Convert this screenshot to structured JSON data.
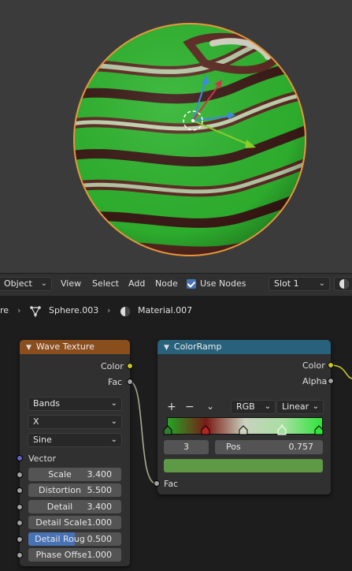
{
  "header": {
    "mode": "Object",
    "menu": [
      "View",
      "Select",
      "Add",
      "Node"
    ],
    "use_nodes_label": "Use Nodes",
    "use_nodes_checked": true,
    "slot": "Slot 1"
  },
  "breadcrumbs": {
    "truncated": "re",
    "object": "Sphere.003",
    "material": "Material.007"
  },
  "wave_node": {
    "title": "Wave Texture",
    "header_color": "#8a4d1c",
    "out_color": "Color",
    "out_fac": "Fac",
    "wave_type": "Bands",
    "direction": "X",
    "profile": "Sine",
    "vector_label": "Vector",
    "params": [
      {
        "label": "Scale",
        "value": "3.400"
      },
      {
        "label": "Distortion",
        "value": "5.500"
      },
      {
        "label": "Detail",
        "value": "3.400"
      },
      {
        "label": "Detail Scale",
        "value": "1.000"
      },
      {
        "label": "Detail Roug",
        "value": "0.500",
        "fraction": 0.5
      },
      {
        "label": "Phase Offse",
        "value": "1.000"
      }
    ]
  },
  "ramp_node": {
    "title": "ColorRamp",
    "header_color": "#27617b",
    "out_color": "Color",
    "out_alpha": "Alpha",
    "color_mode": "RGB",
    "interpolation": "Linear",
    "add_label": "+",
    "remove_label": "−",
    "active_index": "3",
    "pos_label": "Pos",
    "pos_value": "0.757",
    "active_color": "#5e9a45",
    "in_fac": "Fac"
  }
}
